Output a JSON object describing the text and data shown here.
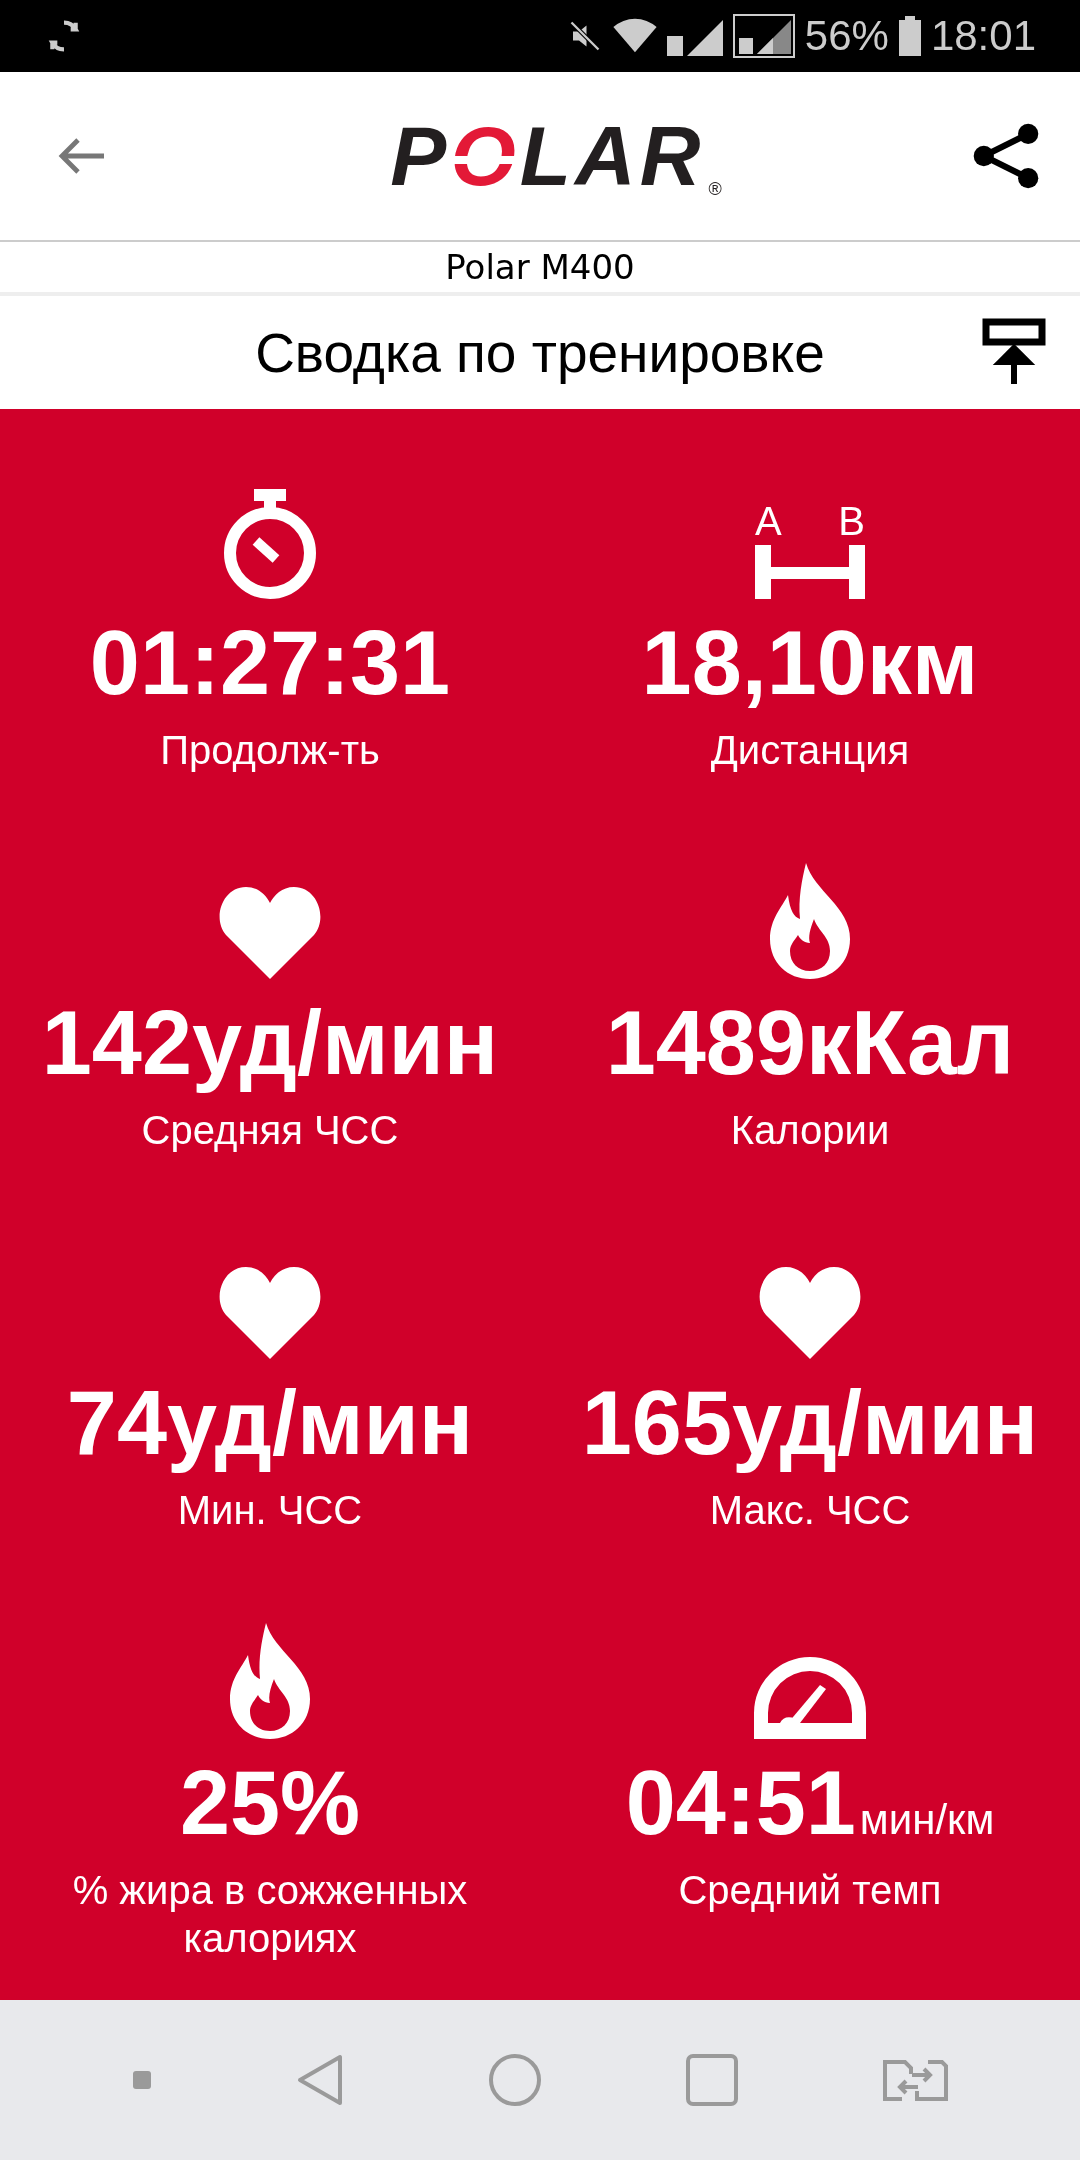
{
  "status_bar": {
    "battery": "56%",
    "time": "18:01"
  },
  "header": {
    "logo": "POLAR",
    "logo_mark": "®"
  },
  "device": {
    "name": "Polar M400"
  },
  "title": "Сводка по тренировке",
  "distance_icon": {
    "labels": [
      "A",
      "B"
    ]
  },
  "stats": [
    {
      "kind": "stopwatch",
      "value": "01:27:31",
      "label": "Продолж-ть"
    },
    {
      "kind": "distance",
      "value": "18,10км",
      "label": "Дистанция"
    },
    {
      "kind": "heart",
      "value": "142уд/мин",
      "label": "Средняя ЧСС"
    },
    {
      "kind": "flame",
      "value": "1489кКал",
      "label": "Калории"
    },
    {
      "kind": "heart",
      "value": "74уд/мин",
      "label": "Мин. ЧСС"
    },
    {
      "kind": "heart",
      "value": "165уд/мин",
      "label": "Макс. ЧСС"
    },
    {
      "kind": "flame",
      "value": "25%",
      "label": "% жира в сожженных калориях"
    },
    {
      "kind": "speedometer",
      "value": "04:51",
      "unit": "мин/км",
      "label": "Средний темп"
    }
  ]
}
